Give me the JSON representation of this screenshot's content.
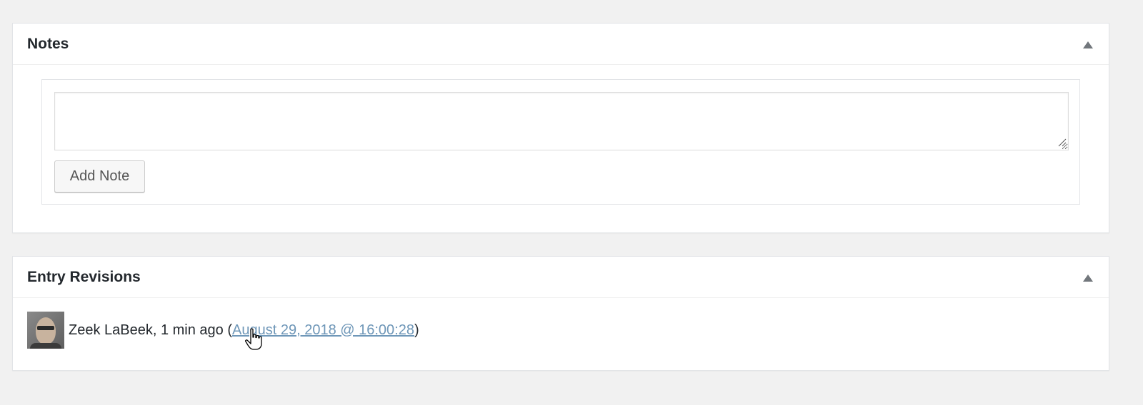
{
  "notes_panel": {
    "title": "Notes",
    "textarea_value": "",
    "add_note_label": "Add Note"
  },
  "revisions_panel": {
    "title": "Entry Revisions",
    "revision": {
      "author_text": "Zeek LaBeek, 1 min ago (",
      "link_text": "August 29, 2018 @ 16:00:28",
      "close_paren": ")"
    }
  },
  "icons": {
    "toggle": "triangle-up-icon",
    "resize": "resize-grip-icon",
    "cursor": "hand-pointer-icon",
    "avatar": "user-avatar"
  },
  "colors": {
    "background": "#f1f1f1",
    "panel": "#ffffff",
    "border": "#e2e4e7",
    "link": "#6f97b8",
    "text": "#23282d"
  }
}
